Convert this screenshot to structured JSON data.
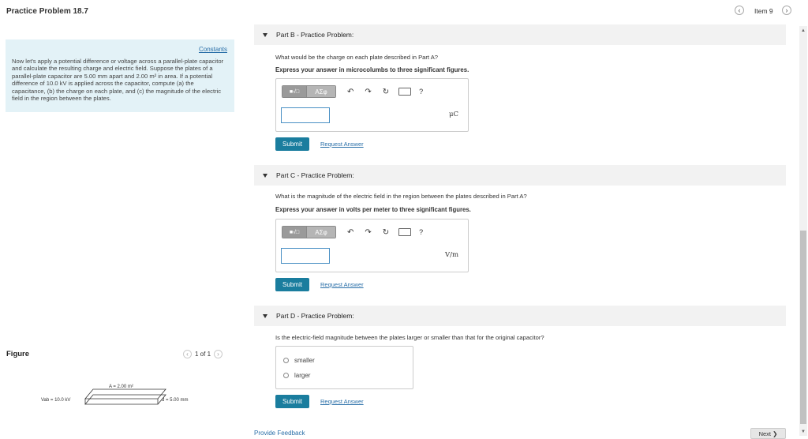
{
  "header": {
    "title": "Practice Problem 18.7",
    "item_label": "Item 9",
    "prev_icon": "chevron-left-icon",
    "next_icon": "chevron-right-icon"
  },
  "problem": {
    "constants_link": "Constants",
    "text": "Now let's apply a potential difference or voltage across a parallel-plate capacitor and calculate the resulting charge and electric field. Suppose the plates of a parallel-plate capacitor are 5.00 mm apart and 2.00 m² in area. If a potential difference of 10.0 kV is applied across the capacitor, compute (a) the capacitance, (b) the charge on each plate, and (c) the magnitude of the electric field in the region between the plates."
  },
  "figure": {
    "label": "Figure",
    "pager": "1 of 1",
    "area_label": "A = 2.00 m²",
    "voltage_label": "Vab = 10.0 kV",
    "distance_label": "d = 5.00 mm"
  },
  "toolbar": {
    "templates_label": "■√□",
    "greek_label": "ΑΣφ",
    "undo_icon": "↶",
    "redo_icon": "↷",
    "reset_icon": "↻",
    "help_label": "?"
  },
  "parts": {
    "b": {
      "header": "Part B - Practice Problem:",
      "question": "What would be the charge on each plate described in Part A?",
      "instruction": "Express your answer in microcolumbs to three significant figures.",
      "input_value": "",
      "unit": "μC",
      "submit": "Submit",
      "request": "Request Answer"
    },
    "c": {
      "header": "Part C - Practice Problem:",
      "question": "What is the magnitude of the electric field in the region between the plates described in Part A?",
      "instruction": "Express your answer in volts per meter to three significant figures.",
      "input_value": "",
      "unit": "V/m",
      "submit": "Submit",
      "request": "Request Answer"
    },
    "d": {
      "header": "Part D - Practice Problem:",
      "question": "Is the electric-field magnitude between the plates larger or smaller than that for the original capacitor?",
      "options": [
        "smaller",
        "larger"
      ],
      "submit": "Submit",
      "request": "Request Answer"
    }
  },
  "footer": {
    "feedback": "Provide Feedback",
    "next": "Next ❯"
  },
  "colors": {
    "accent": "#1a7d9e",
    "link": "#2a6fa8",
    "problem_bg": "#e3f2f7"
  }
}
